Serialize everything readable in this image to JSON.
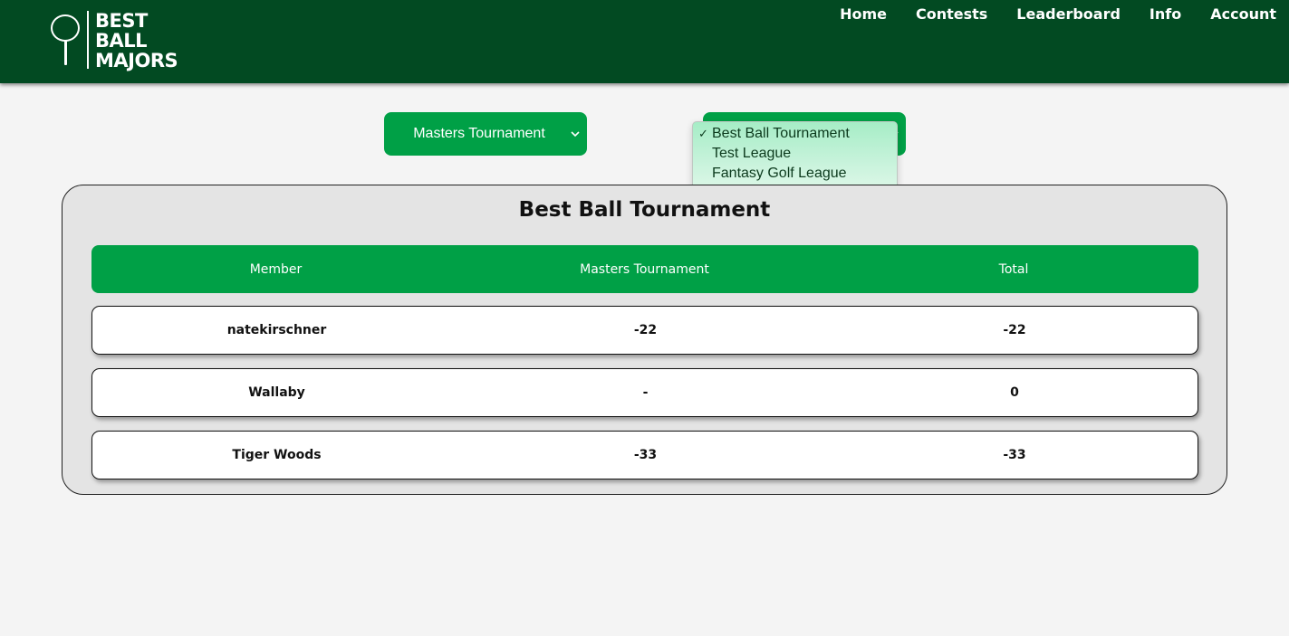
{
  "brand": {
    "line1": "BEST",
    "line2": "BALL",
    "line3": "MAJORS"
  },
  "nav": [
    "Home",
    "Contests",
    "Leaderboard",
    "Info",
    "Account"
  ],
  "tournament_select": {
    "value": "Masters Tournament"
  },
  "league_dropdown": {
    "options": [
      "Best Ball Tournament",
      "Test League",
      "Fantasy Golf League"
    ],
    "selected_index": 0,
    "check_mark": "✓"
  },
  "leaderboard": {
    "title": "Best Ball Tournament",
    "columns": [
      "Member",
      "Masters Tournament",
      "Total"
    ],
    "rows": [
      [
        "natekirschner",
        "-22",
        "-22"
      ],
      [
        "Wallaby",
        "-",
        "0"
      ],
      [
        "Tiger Woods",
        "-33",
        "-33"
      ]
    ]
  },
  "colors": {
    "header": "#024a22",
    "accent": "#00a046",
    "background": "#f4f4f4"
  }
}
